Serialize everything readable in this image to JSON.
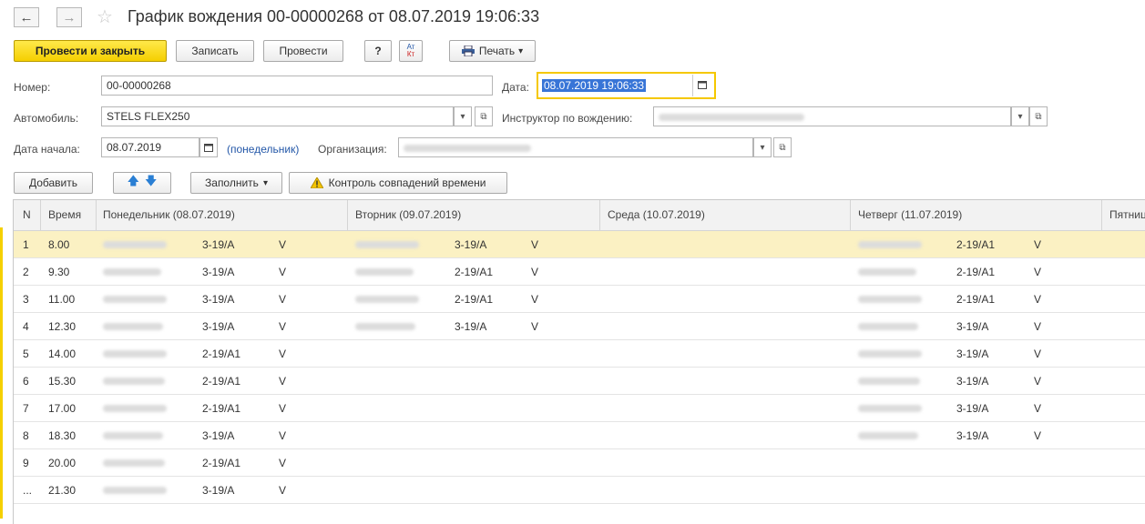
{
  "header": {
    "title": "График вождения 00-00000268 от 08.07.2019 19:06:33",
    "back_glyph": "←",
    "forward_glyph": "→",
    "favorite_glyph": "☆"
  },
  "toolbar": {
    "post_close": "Провести и закрыть",
    "save": "Записать",
    "post": "Провести",
    "help": "?",
    "dtkt_top": "Ат",
    "dtkt_bottom": "Кт",
    "print": "Печать",
    "print_arrow": "▾"
  },
  "form": {
    "number_label": "Номер:",
    "number_value": "00-00000268",
    "date_label": "Дата:",
    "date_value": "08.07.2019 19:06:33",
    "car_label": "Автомобиль:",
    "car_value": "STELS FLEX250",
    "instructor_label": "Инструктор по вождению:",
    "start_label": "Дата начала:",
    "start_value": "08.07.2019",
    "weekday": "(понедельник)",
    "org_label": "Организация:"
  },
  "table_toolbar": {
    "add": "Добавить",
    "up": "🡅",
    "down": "🡇",
    "fill": "Заполнить",
    "check": "Контроль совпадений времени"
  },
  "columns": {
    "n": "N",
    "time": "Время",
    "mon": "Понедельник (08.07.2019)",
    "tue": "Вторник (09.07.2019)",
    "wed": "Среда (10.07.2019)",
    "thu": "Четверг (11.07.2019)",
    "fri": "Пятниц"
  },
  "rows": [
    {
      "n": "1",
      "time": "8.00",
      "mon_cat": "3-19/A",
      "mon_mark": "V",
      "tue_cat": "3-19/A",
      "tue_mark": "V",
      "thu_cat": "2-19/A1",
      "thu_mark": "V"
    },
    {
      "n": "2",
      "time": "9.30",
      "mon_cat": "3-19/A",
      "mon_mark": "V",
      "tue_cat": "2-19/A1",
      "tue_mark": "V",
      "thu_cat": "2-19/A1",
      "thu_mark": "V"
    },
    {
      "n": "3",
      "time": "11.00",
      "mon_cat": "3-19/A",
      "mon_mark": "V",
      "tue_cat": "2-19/A1",
      "tue_mark": "V",
      "thu_cat": "2-19/A1",
      "thu_mark": "V"
    },
    {
      "n": "4",
      "time": "12.30",
      "mon_cat": "3-19/A",
      "mon_mark": "V",
      "tue_cat": "3-19/A",
      "tue_mark": "V",
      "thu_cat": "3-19/A",
      "thu_mark": "V"
    },
    {
      "n": "5",
      "time": "14.00",
      "mon_cat": "2-19/A1",
      "mon_mark": "V",
      "tue_cat": "",
      "tue_mark": "",
      "thu_cat": "3-19/A",
      "thu_mark": "V"
    },
    {
      "n": "6",
      "time": "15.30",
      "mon_cat": "2-19/A1",
      "mon_mark": "V",
      "tue_cat": "",
      "tue_mark": "",
      "thu_cat": "3-19/A",
      "thu_mark": "V"
    },
    {
      "n": "7",
      "time": "17.00",
      "mon_cat": "2-19/A1",
      "mon_mark": "V",
      "tue_cat": "",
      "tue_mark": "",
      "thu_cat": "3-19/A",
      "thu_mark": "V"
    },
    {
      "n": "8",
      "time": "18.30",
      "mon_cat": "3-19/A",
      "mon_mark": "V",
      "tue_cat": "",
      "tue_mark": "",
      "thu_cat": "3-19/A",
      "thu_mark": "V"
    },
    {
      "n": "9",
      "time": "20.00",
      "mon_cat": "2-19/A1",
      "mon_mark": "V",
      "tue_cat": "",
      "tue_mark": "",
      "thu_cat": "",
      "thu_mark": ""
    },
    {
      "n": "...",
      "time": "21.30",
      "mon_cat": "3-19/A",
      "mon_mark": "V",
      "tue_cat": "",
      "tue_mark": "",
      "thu_cat": "",
      "thu_mark": ""
    }
  ]
}
